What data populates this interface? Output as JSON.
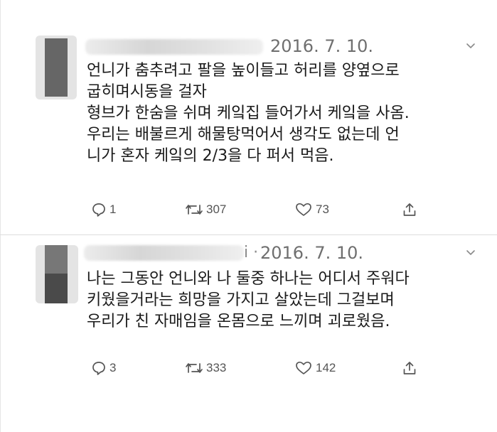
{
  "tweets": [
    {
      "author_name": "",
      "date": "2016. 7. 10.",
      "text_lines": [
        "언니가 춤추려고  팔을 높이들고 허리를 양옆으로",
        "굽히며시동을 걸자",
        "형브가 한숨을 쉬며 케잌집 들어가서 케잌을 사옴.",
        "우리는 배불르게 해물탕먹어서 생각도 없는데 언",
        "니가 혼자 케잌의 2/3을 다 퍼서 먹음."
      ],
      "replies": "1",
      "retweets": "307",
      "likes": "73"
    },
    {
      "author_name": "",
      "handle_tail": "i ·",
      "date": "2016. 7. 10.",
      "text_lines": [
        "나는 그동안 언니와 나 둘중 하나는 어디서 주워다",
        "키웠을거라는 희망을 가지고 살았는데  그걸보며",
        "우리가 친 자매임을 온몸으로 느끼며 괴로웠음."
      ],
      "replies": "3",
      "retweets": "333",
      "likes": "142"
    }
  ],
  "icons": {
    "reply": "reply-icon",
    "retweet": "retweet-icon",
    "like": "heart-icon",
    "share": "share-icon",
    "menu": "chevron-down-icon"
  },
  "colors": {
    "text": "#1a1a1a",
    "meta": "#6f6f6f",
    "icon": "#555555",
    "background": "#ffffff"
  }
}
